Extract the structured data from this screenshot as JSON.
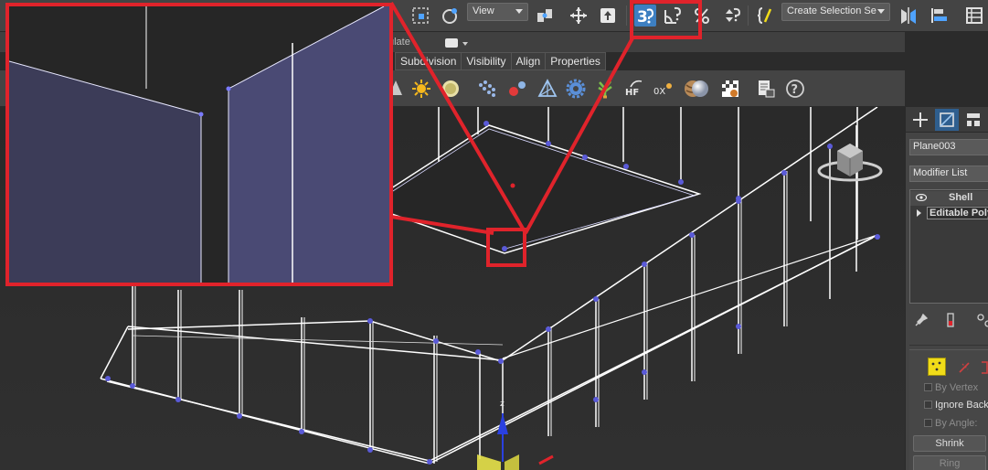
{
  "toolbar": {
    "view_dropdown": "View",
    "selection_set_placeholder": "Create Selection Se"
  },
  "ribbon": {
    "populate_label": "ulate",
    "tabs": [
      "Subdivision",
      "Visibility",
      "Align",
      "Properties"
    ]
  },
  "viewport": {
    "axis_label": "z"
  },
  "command_panel": {
    "object_name": "Plane003",
    "modifier_list": "Modifier List",
    "stack": [
      "Shell",
      "Editable Poly"
    ],
    "checkboxes": [
      "By Vertex",
      "Ignore Backf",
      "By Angle:"
    ],
    "buttons": [
      "Shrink",
      "Ring"
    ]
  },
  "colors": {
    "highlight": "#e0232b",
    "selection_yellow": "#f1dc18",
    "wire_white": "#ffffff",
    "vertex_blue": "#5a5ad8",
    "zoom_face": "#4a4a78"
  }
}
